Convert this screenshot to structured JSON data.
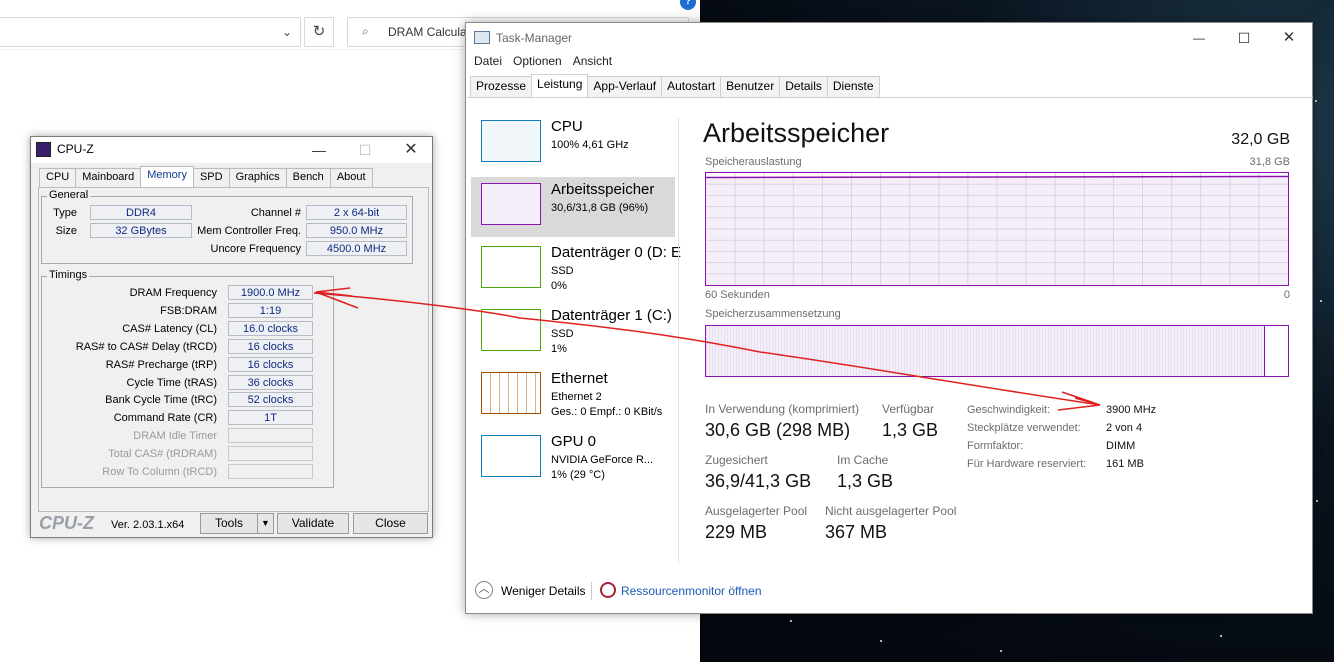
{
  "explorer": {
    "search_text": "DRAM Calcula",
    "refresh_icon": "refresh-icon",
    "search_icon": "search-icon"
  },
  "cpuz": {
    "title": "CPU-Z",
    "tabs": [
      "CPU",
      "Mainboard",
      "Memory",
      "SPD",
      "Graphics",
      "Bench",
      "About"
    ],
    "active_tab": "Memory",
    "general": {
      "title": "General",
      "type_label": "Type",
      "type_value": "DDR4",
      "size_label": "Size",
      "size_value": "32 GBytes",
      "channel_label": "Channel #",
      "channel_value": "2 x 64-bit",
      "mem_ctrl_label": "Mem Controller Freq.",
      "mem_ctrl_value": "950.0 MHz",
      "uncore_label": "Uncore Frequency",
      "uncore_value": "4500.0 MHz"
    },
    "timings": {
      "title": "Timings",
      "rows": [
        {
          "label": "DRAM Frequency",
          "value": "1900.0 MHz",
          "dim": false
        },
        {
          "label": "FSB:DRAM",
          "value": "1:19",
          "dim": false
        },
        {
          "label": "CAS# Latency (CL)",
          "value": "16.0 clocks",
          "dim": false
        },
        {
          "label": "RAS# to CAS# Delay (tRCD)",
          "value": "16 clocks",
          "dim": false
        },
        {
          "label": "RAS# Precharge (tRP)",
          "value": "16 clocks",
          "dim": false
        },
        {
          "label": "Cycle Time (tRAS)",
          "value": "36 clocks",
          "dim": false
        },
        {
          "label": "Bank Cycle Time (tRC)",
          "value": "52 clocks",
          "dim": false
        },
        {
          "label": "Command Rate (CR)",
          "value": "1T",
          "dim": false
        },
        {
          "label": "DRAM Idle Timer",
          "value": "",
          "dim": true
        },
        {
          "label": "Total CAS# (tRDRAM)",
          "value": "",
          "dim": true
        },
        {
          "label": "Row To Column (tRCD)",
          "value": "",
          "dim": true
        }
      ]
    },
    "footer": {
      "brand": "CPU-Z",
      "version": "Ver. 2.03.1.x64",
      "tools": "Tools",
      "validate": "Validate",
      "close": "Close"
    }
  },
  "taskmanager": {
    "title": "Task-Manager",
    "menu": [
      "Datei",
      "Optionen",
      "Ansicht"
    ],
    "tabs": [
      "Prozesse",
      "Leistung",
      "App-Verlauf",
      "Autostart",
      "Benutzer",
      "Details",
      "Dienste"
    ],
    "active_tab": "Leistung",
    "sidebar": [
      {
        "title": "CPU",
        "sub1": "100% 4,61 GHz",
        "sub2": "",
        "sub3": "",
        "color": "#117dbb",
        "selected": false
      },
      {
        "title": "Arbeitsspeicher",
        "sub1": "30,6/31,8 GB (96%)",
        "sub2": "",
        "sub3": "",
        "color": "#8b12ae",
        "selected": true
      },
      {
        "title": "Datenträger 0 (D: E",
        "sub1": "SSD",
        "sub2": "0%",
        "sub3": "",
        "color": "#4da60c",
        "selected": false
      },
      {
        "title": "Datenträger 1 (C:)",
        "sub1": "SSD",
        "sub2": "1%",
        "sub3": "",
        "color": "#4da60c",
        "selected": false
      },
      {
        "title": "Ethernet",
        "sub1": "Ethernet 2",
        "sub2": "Ges.: 0 Empf.: 0 KBit/s",
        "sub3": "",
        "color": "#a74f01",
        "selected": false
      },
      {
        "title": "GPU 0",
        "sub1": "NVIDIA GeForce R...",
        "sub2": "1% (29 °C)",
        "sub3": "",
        "color": "#117dbb",
        "selected": false
      }
    ],
    "main": {
      "heading": "Arbeitsspeicher",
      "total": "32,0 GB",
      "usage_label": "Speicherauslastung",
      "usage_max": "31,8 GB",
      "time_label": "60 Sekunden",
      "time_end": "0",
      "composition_label": "Speicherzusammensetzung",
      "accent": "#8b12ae",
      "usage_fraction": 0.96,
      "stats": {
        "in_use_label": "In Verwendung (komprimiert)",
        "in_use_value": "30,6 GB (298 MB)",
        "available_label": "Verfügbar",
        "available_value": "1,3 GB",
        "committed_label": "Zugesichert",
        "committed_value": "36,9/41,3 GB",
        "cached_label": "Im Cache",
        "cached_value": "1,3 GB",
        "paged_label": "Ausgelagerter Pool",
        "paged_value": "229 MB",
        "nonpaged_label": "Nicht ausgelagerter Pool",
        "nonpaged_value": "367 MB"
      },
      "details": [
        {
          "key": "Geschwindigkeit:",
          "value": "3900 MHz"
        },
        {
          "key": "Steckplätze verwendet:",
          "value": "2 von 4"
        },
        {
          "key": "Formfaktor:",
          "value": "DIMM"
        },
        {
          "key": "Für Hardware reserviert:",
          "value": "161 MB"
        }
      ]
    },
    "footer": {
      "fewer_details": "Weniger Details",
      "resource_monitor": "Ressourcenmonitor öffnen"
    }
  },
  "annotation": {
    "color": "#e02020"
  }
}
